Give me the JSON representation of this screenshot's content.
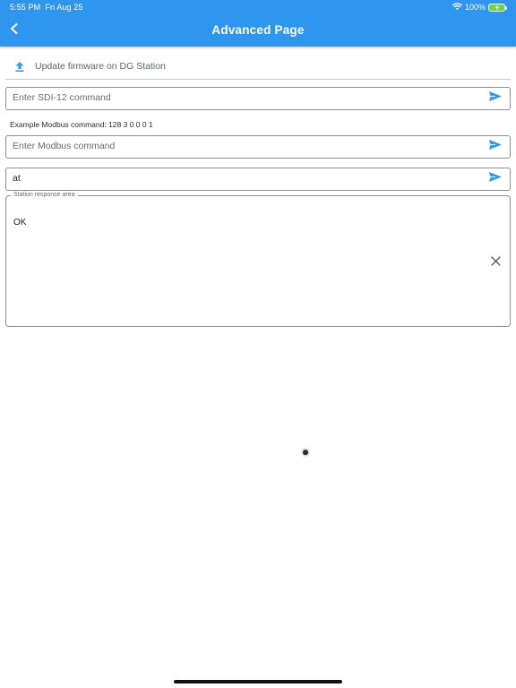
{
  "status_bar": {
    "time": "5:55 PM",
    "date": "Fri Aug 25",
    "battery_percent": "100%"
  },
  "app_bar": {
    "title": "Advanced Page",
    "back_icon": "chevron-left-icon"
  },
  "firmware": {
    "label": "Update firmware on DG Station",
    "icon": "upload-icon"
  },
  "sdi12": {
    "placeholder": "Enter SDI-12 command",
    "value": ""
  },
  "modbus": {
    "example": "Example Modbus command: 128 3 0 0 0 1",
    "placeholder": "Enter Modbus command",
    "value": ""
  },
  "at_command": {
    "placeholder": "",
    "value": "at"
  },
  "response": {
    "legend": "Station response area",
    "text": "OK",
    "clear_icon": "close-icon"
  },
  "colors": {
    "app_bar": "#2f96f0",
    "accent": "#2f96f0",
    "battery_fill": "#6ad84a"
  }
}
